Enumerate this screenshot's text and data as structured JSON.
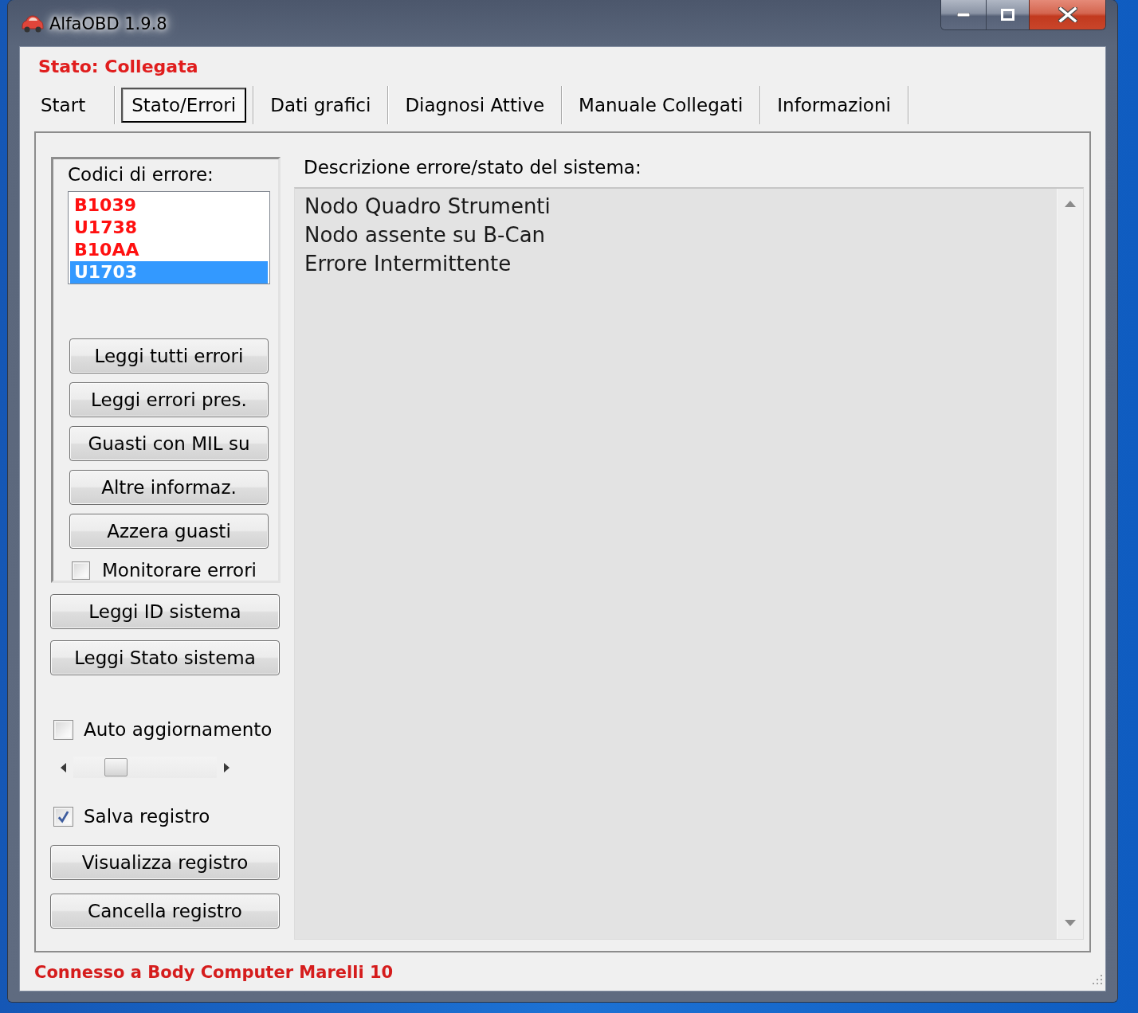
{
  "window": {
    "title": "AlfaOBD 1.9.8"
  },
  "connection_state": "Stato: Collegata",
  "tabs": [
    {
      "label": "Start",
      "selected": false
    },
    {
      "label": "Stato/Errori",
      "selected": true
    },
    {
      "label": "Dati grafici",
      "selected": false
    },
    {
      "label": "Diagnosi Attive",
      "selected": false
    },
    {
      "label": "Manuale Collegati",
      "selected": false
    },
    {
      "label": "Informazioni",
      "selected": false
    }
  ],
  "error_codes": {
    "label": "Codici di errore:",
    "items": [
      {
        "code": "B1039",
        "selected": false
      },
      {
        "code": "U1738",
        "selected": false
      },
      {
        "code": "B10AA",
        "selected": false
      },
      {
        "code": "U1703",
        "selected": true
      }
    ],
    "buttons": [
      "Leggi tutti errori",
      "Leggi errori pres.",
      "Guasti con MIL su",
      "Altre informaz.",
      "Azzera guasti"
    ],
    "monitor": {
      "label": "Monitorare errori",
      "checked": false
    }
  },
  "system_buttons": [
    "Leggi ID sistema",
    "Leggi Stato sistema"
  ],
  "auto_update": {
    "label": "Auto aggiornamento",
    "checked": false
  },
  "update_interval": {
    "level": 0.26
  },
  "save_log": {
    "label": "Salva registro",
    "checked": true
  },
  "log_buttons": [
    "Visualizza registro",
    "Cancella registro"
  ],
  "description": {
    "label": "Descrizione errore/stato del sistema:",
    "lines": [
      "Nodo Quadro Strumenti",
      "Nodo assente su B-Can",
      "Errore Intermittente"
    ]
  },
  "status_bar": "Connesso a Body Computer Marelli 10"
}
